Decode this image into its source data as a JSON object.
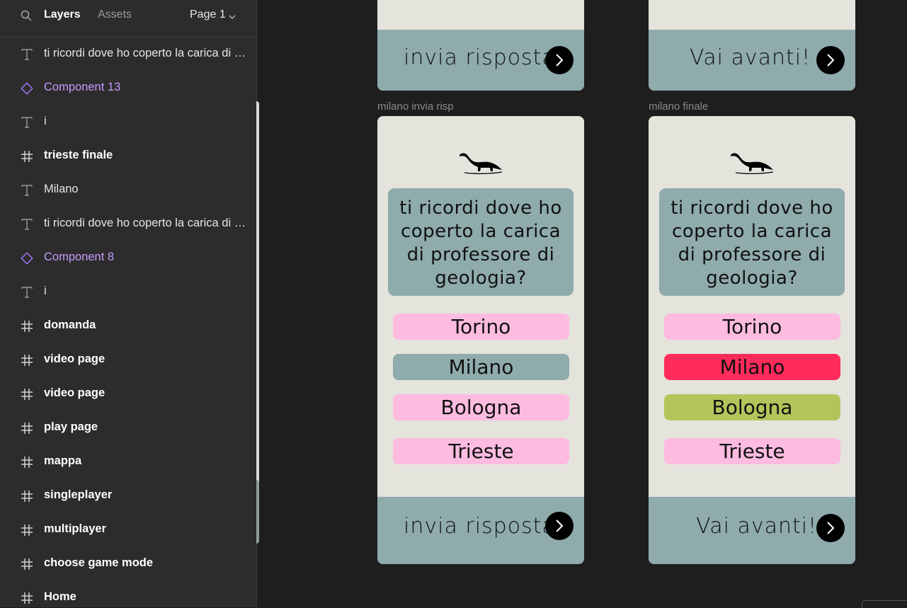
{
  "panel": {
    "tabs": {
      "layers": "Layers",
      "assets": "Assets"
    },
    "page": "Page 1",
    "layers": [
      {
        "type": "text",
        "icon": "text-icon",
        "label": "ti ricordi dove ho coperto la carica di professore di geologia?"
      },
      {
        "type": "component",
        "icon": "component-icon",
        "label": "Component 13"
      },
      {
        "type": "text",
        "icon": "text-icon",
        "label": "i"
      },
      {
        "type": "frame",
        "icon": "frame-icon",
        "label": "trieste finale"
      },
      {
        "type": "text",
        "icon": "text-icon",
        "label": "Milano"
      },
      {
        "type": "text",
        "icon": "text-icon",
        "label": "ti ricordi dove ho coperto la carica di professore di geologia?"
      },
      {
        "type": "component",
        "icon": "component-icon",
        "label": "Component 8"
      },
      {
        "type": "text",
        "icon": "text-icon",
        "label": "i"
      },
      {
        "type": "frame",
        "icon": "frame-icon",
        "label": "domanda"
      },
      {
        "type": "frame",
        "icon": "frame-icon",
        "label": "video page"
      },
      {
        "type": "frame",
        "icon": "frame-icon",
        "label": "video page"
      },
      {
        "type": "frame",
        "icon": "frame-icon",
        "label": "play page"
      },
      {
        "type": "frame",
        "icon": "frame-icon",
        "label": "mappa"
      },
      {
        "type": "frame",
        "icon": "frame-icon",
        "label": "singleplayer"
      },
      {
        "type": "frame",
        "icon": "frame-icon",
        "label": "multiplayer"
      },
      {
        "type": "frame",
        "icon": "frame-icon",
        "label": "choose game mode"
      },
      {
        "type": "frame",
        "icon": "frame-icon",
        "label": "Home"
      }
    ]
  },
  "canvas": {
    "top_left": {
      "footer_text": "invia risposta!"
    },
    "top_right": {
      "footer_text": "Vai avanti!"
    },
    "left_frame": {
      "name": "milano invia risp",
      "question": "ti ricordi dove ho coperto la carica di professore di geologia?",
      "answers": [
        "Torino",
        "Milano",
        "Bologna",
        "Trieste"
      ],
      "answer_colors": [
        "#fdbbe0",
        "#8fabac",
        "#fdbbe0",
        "#fdbbe0"
      ],
      "footer_text": "invia risposta!"
    },
    "right_frame": {
      "name": "milano finale",
      "question": "ti ricordi dove ho coperto la carica di professore di geologia?",
      "answers": [
        "Torino",
        "Milano",
        "Bologna",
        "Trieste"
      ],
      "answer_colors": [
        "#fdbbe0",
        "#ff2b5b",
        "#b5c45a",
        "#fdbbe0"
      ],
      "footer_text": "Vai avanti!"
    }
  },
  "colors": {
    "frame_bg": "#e4e3dc",
    "teal": "#8fabac",
    "pink": "#fdbbe0",
    "wrong_red": "#ff2b5b",
    "correct_green": "#b5c45a",
    "component_purple": "#c49bff"
  }
}
